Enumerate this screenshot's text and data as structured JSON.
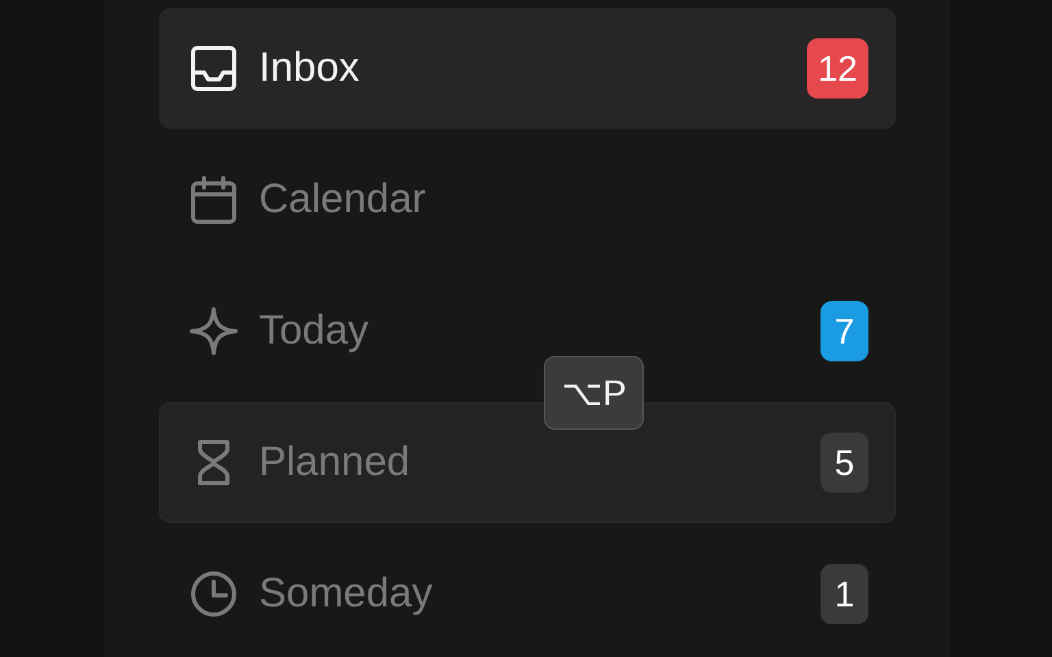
{
  "sidebar": {
    "items": [
      {
        "label": "Inbox",
        "selected": true,
        "hovered": false,
        "badge": "12",
        "color": "#e5484d"
      },
      {
        "label": "Calendar",
        "selected": false,
        "hovered": false
      },
      {
        "label": "Today",
        "selected": false,
        "hovered": false,
        "badge": "7",
        "color": "#1a9be2"
      },
      {
        "label": "Planned",
        "selected": false,
        "hovered": true,
        "badge": "5",
        "color": "#3a3a3a",
        "tooltip": "⌥P"
      },
      {
        "label": "Someday",
        "selected": false,
        "hovered": false,
        "badge": "1",
        "color": "#3a3a3a"
      }
    ]
  }
}
